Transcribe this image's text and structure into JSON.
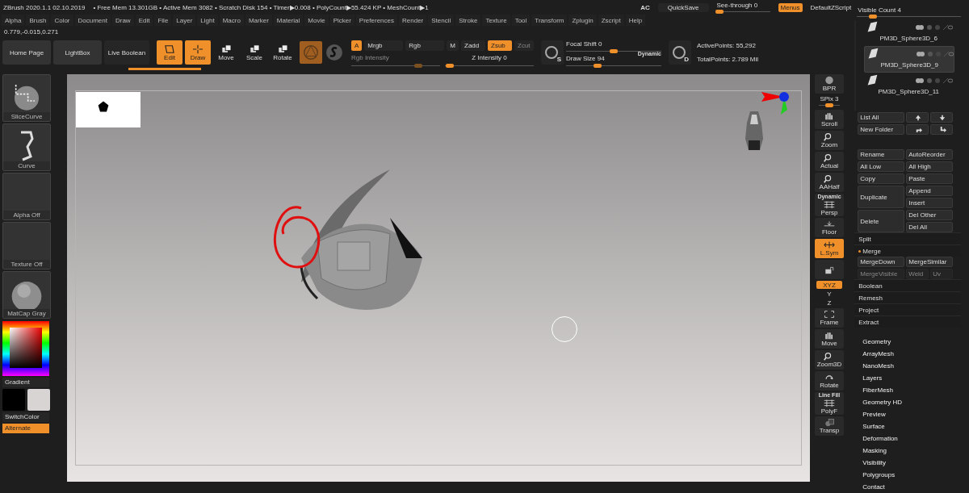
{
  "title_bar": {
    "app": "ZBrush 2020.1.1 02.10.2019",
    "stats": "• Free Mem 13.301GB • Active Mem 3082 • Scratch Disk 154 •  Timer▶0.008 • PolyCount▶55.424 KP • MeshCount▶1",
    "ac": "AC",
    "quicksave": "QuickSave",
    "see_through": {
      "label": "See-through  0",
      "level": 0.05
    },
    "menus_button": {
      "label": "Menus",
      "on": true
    },
    "script": "DefaultZScript"
  },
  "menus": [
    "Alpha",
    "Brush",
    "Color",
    "Document",
    "Draw",
    "Edit",
    "File",
    "Layer",
    "Light",
    "Macro",
    "Marker",
    "Material",
    "Movie",
    "Picker",
    "Preferences",
    "Render",
    "Stencil",
    "Stroke",
    "Texture",
    "Tool",
    "Transform",
    "Zplugin",
    "Zscript",
    "Help"
  ],
  "coordinates": "0.779,-0.015,0.271",
  "toolbar": {
    "nav": [
      {
        "label": "Home Page"
      },
      {
        "label": "LightBox"
      },
      {
        "label": "Live Boolean"
      }
    ],
    "modes": [
      {
        "label": "Edit",
        "kind": "edit",
        "selected": true
      },
      {
        "label": "Draw",
        "kind": "draw",
        "selected": true
      },
      {
        "label": "Move",
        "kind": "move",
        "selected": false
      },
      {
        "label": "Scale",
        "kind": "scale",
        "selected": false
      },
      {
        "label": "Rotate",
        "kind": "rotate",
        "selected": false
      }
    ],
    "channels": [
      {
        "label": "A",
        "on": true,
        "disabled": false
      },
      {
        "label": "Mrgb",
        "on": false,
        "disabled": false
      },
      {
        "label": "Rgb",
        "on": false,
        "disabled": false
      },
      {
        "label": "M",
        "on": false,
        "disabled": false
      },
      {
        "label": "Zadd",
        "on": false,
        "disabled": false
      },
      {
        "label": "Zsub",
        "on": true,
        "disabled": false
      },
      {
        "label": "Zcut",
        "on": false,
        "disabled": true
      }
    ],
    "rgb_intensity": {
      "label": "Rgb Intensity",
      "disabled": true,
      "level": 0.75
    },
    "z_intensity": {
      "label": "Z Intensity 0",
      "level": 0.05
    },
    "focal_shift": {
      "label": "Focal Shift 0",
      "level": 0.5
    },
    "draw_size": {
      "label": "Draw Size 94",
      "level": 0.33
    },
    "dynamic": "Dynamic",
    "s_letter": "S",
    "d_letter": "D",
    "active_points": "ActivePoints: 55,292",
    "total_points": "TotalPoints: 2.789 Mil"
  },
  "left_panel": {
    "tiles": [
      {
        "label": "SliceCurve",
        "kind": "slicecurve"
      },
      {
        "label": "Curve",
        "kind": "curve"
      },
      {
        "label": "Alpha Off",
        "kind": "empty"
      },
      {
        "label": "Texture Off",
        "kind": "empty"
      },
      {
        "label": "MatCap Gray",
        "kind": "sphere"
      }
    ],
    "gradient": "Gradient",
    "switch_color": "SwitchColor",
    "alternate": {
      "label": "Alternate",
      "on": true
    }
  },
  "right_toolbar": [
    {
      "label": "BPR",
      "kind": "sphere",
      "on": false
    },
    {
      "label": "SPix 3",
      "kind": "slider",
      "level": 0.5,
      "on": false
    },
    {
      "label": "Scroll",
      "kind": "hand",
      "on": false
    },
    {
      "label": "Zoom",
      "kind": "magnifier",
      "on": false
    },
    {
      "label": "Actual",
      "kind": "magnifier",
      "on": false
    },
    {
      "label": "AAHalf",
      "kind": "magnifier",
      "on": false
    },
    {
      "label": "Persp",
      "top": "Dynamic",
      "kind": "grid",
      "on": false
    },
    {
      "label": "Floor",
      "kind": "floor",
      "on": false
    },
    {
      "label": "L.Sym",
      "kind": "arrows",
      "on": true
    },
    {
      "kind": "lock",
      "on": false
    },
    {
      "label": "XYZ",
      "kind": "pill",
      "on": true
    },
    {
      "label": "Y",
      "kind": "rot",
      "on": false
    },
    {
      "label": "Z",
      "kind": "rot",
      "on": false
    },
    {
      "label": "Frame",
      "kind": "frame",
      "on": false
    },
    {
      "label": "Move",
      "kind": "hand",
      "on": false
    },
    {
      "label": "Zoom3D",
      "kind": "magnifier",
      "on": false
    },
    {
      "label": "Rotate",
      "kind": "rotate",
      "on": false
    },
    {
      "label": "PolyF",
      "top": "Line Fill",
      "kind": "grid",
      "on": false
    },
    {
      "label": "Transp",
      "kind": "transp",
      "on": false
    }
  ],
  "subtool": {
    "visible_count": {
      "label": "Visible Count 4",
      "level": 0.15
    },
    "items": [
      {
        "name": "PM3D_Sphere3D_6",
        "selected": false
      },
      {
        "name": "PM3D_Sphere3D_9",
        "selected": true
      },
      {
        "name": "PM3D_Sphere3D_11",
        "selected": false
      }
    ],
    "list_buttons": [
      {
        "label": "List All"
      },
      {
        "label": "New Folder"
      }
    ],
    "actions": [
      [
        "Rename",
        "AutoReorder"
      ],
      [
        "All Low",
        "All High"
      ],
      [
        "Copy",
        "Paste"
      ]
    ],
    "duplicate": {
      "label": "Duplicate",
      "side": [
        "Append",
        "Insert"
      ]
    },
    "delete": {
      "label": "Delete",
      "side": [
        "Del Other",
        "Del All"
      ]
    },
    "split": "Split",
    "merge": {
      "label": "Merge",
      "expanded": true
    },
    "merge_buttons": [
      {
        "label": "MergeDown",
        "disabled": false
      },
      {
        "label": "MergeSimilar",
        "disabled": false
      }
    ],
    "merge_buttons_2": [
      {
        "label": "MergeVisible",
        "disabled": true
      },
      {
        "label": "Weld",
        "disabled": true
      },
      {
        "label": "Uv",
        "disabled": true
      }
    ],
    "rows": [
      "Boolean",
      "Remesh",
      "Project",
      "Extract"
    ]
  },
  "sections": [
    "Geometry",
    "ArrayMesh",
    "NanoMesh",
    "Layers",
    "FiberMesh",
    "Geometry HD",
    "Preview",
    "Surface",
    "Deformation",
    "Masking",
    "Visibility",
    "Polygroups",
    "Contact"
  ]
}
